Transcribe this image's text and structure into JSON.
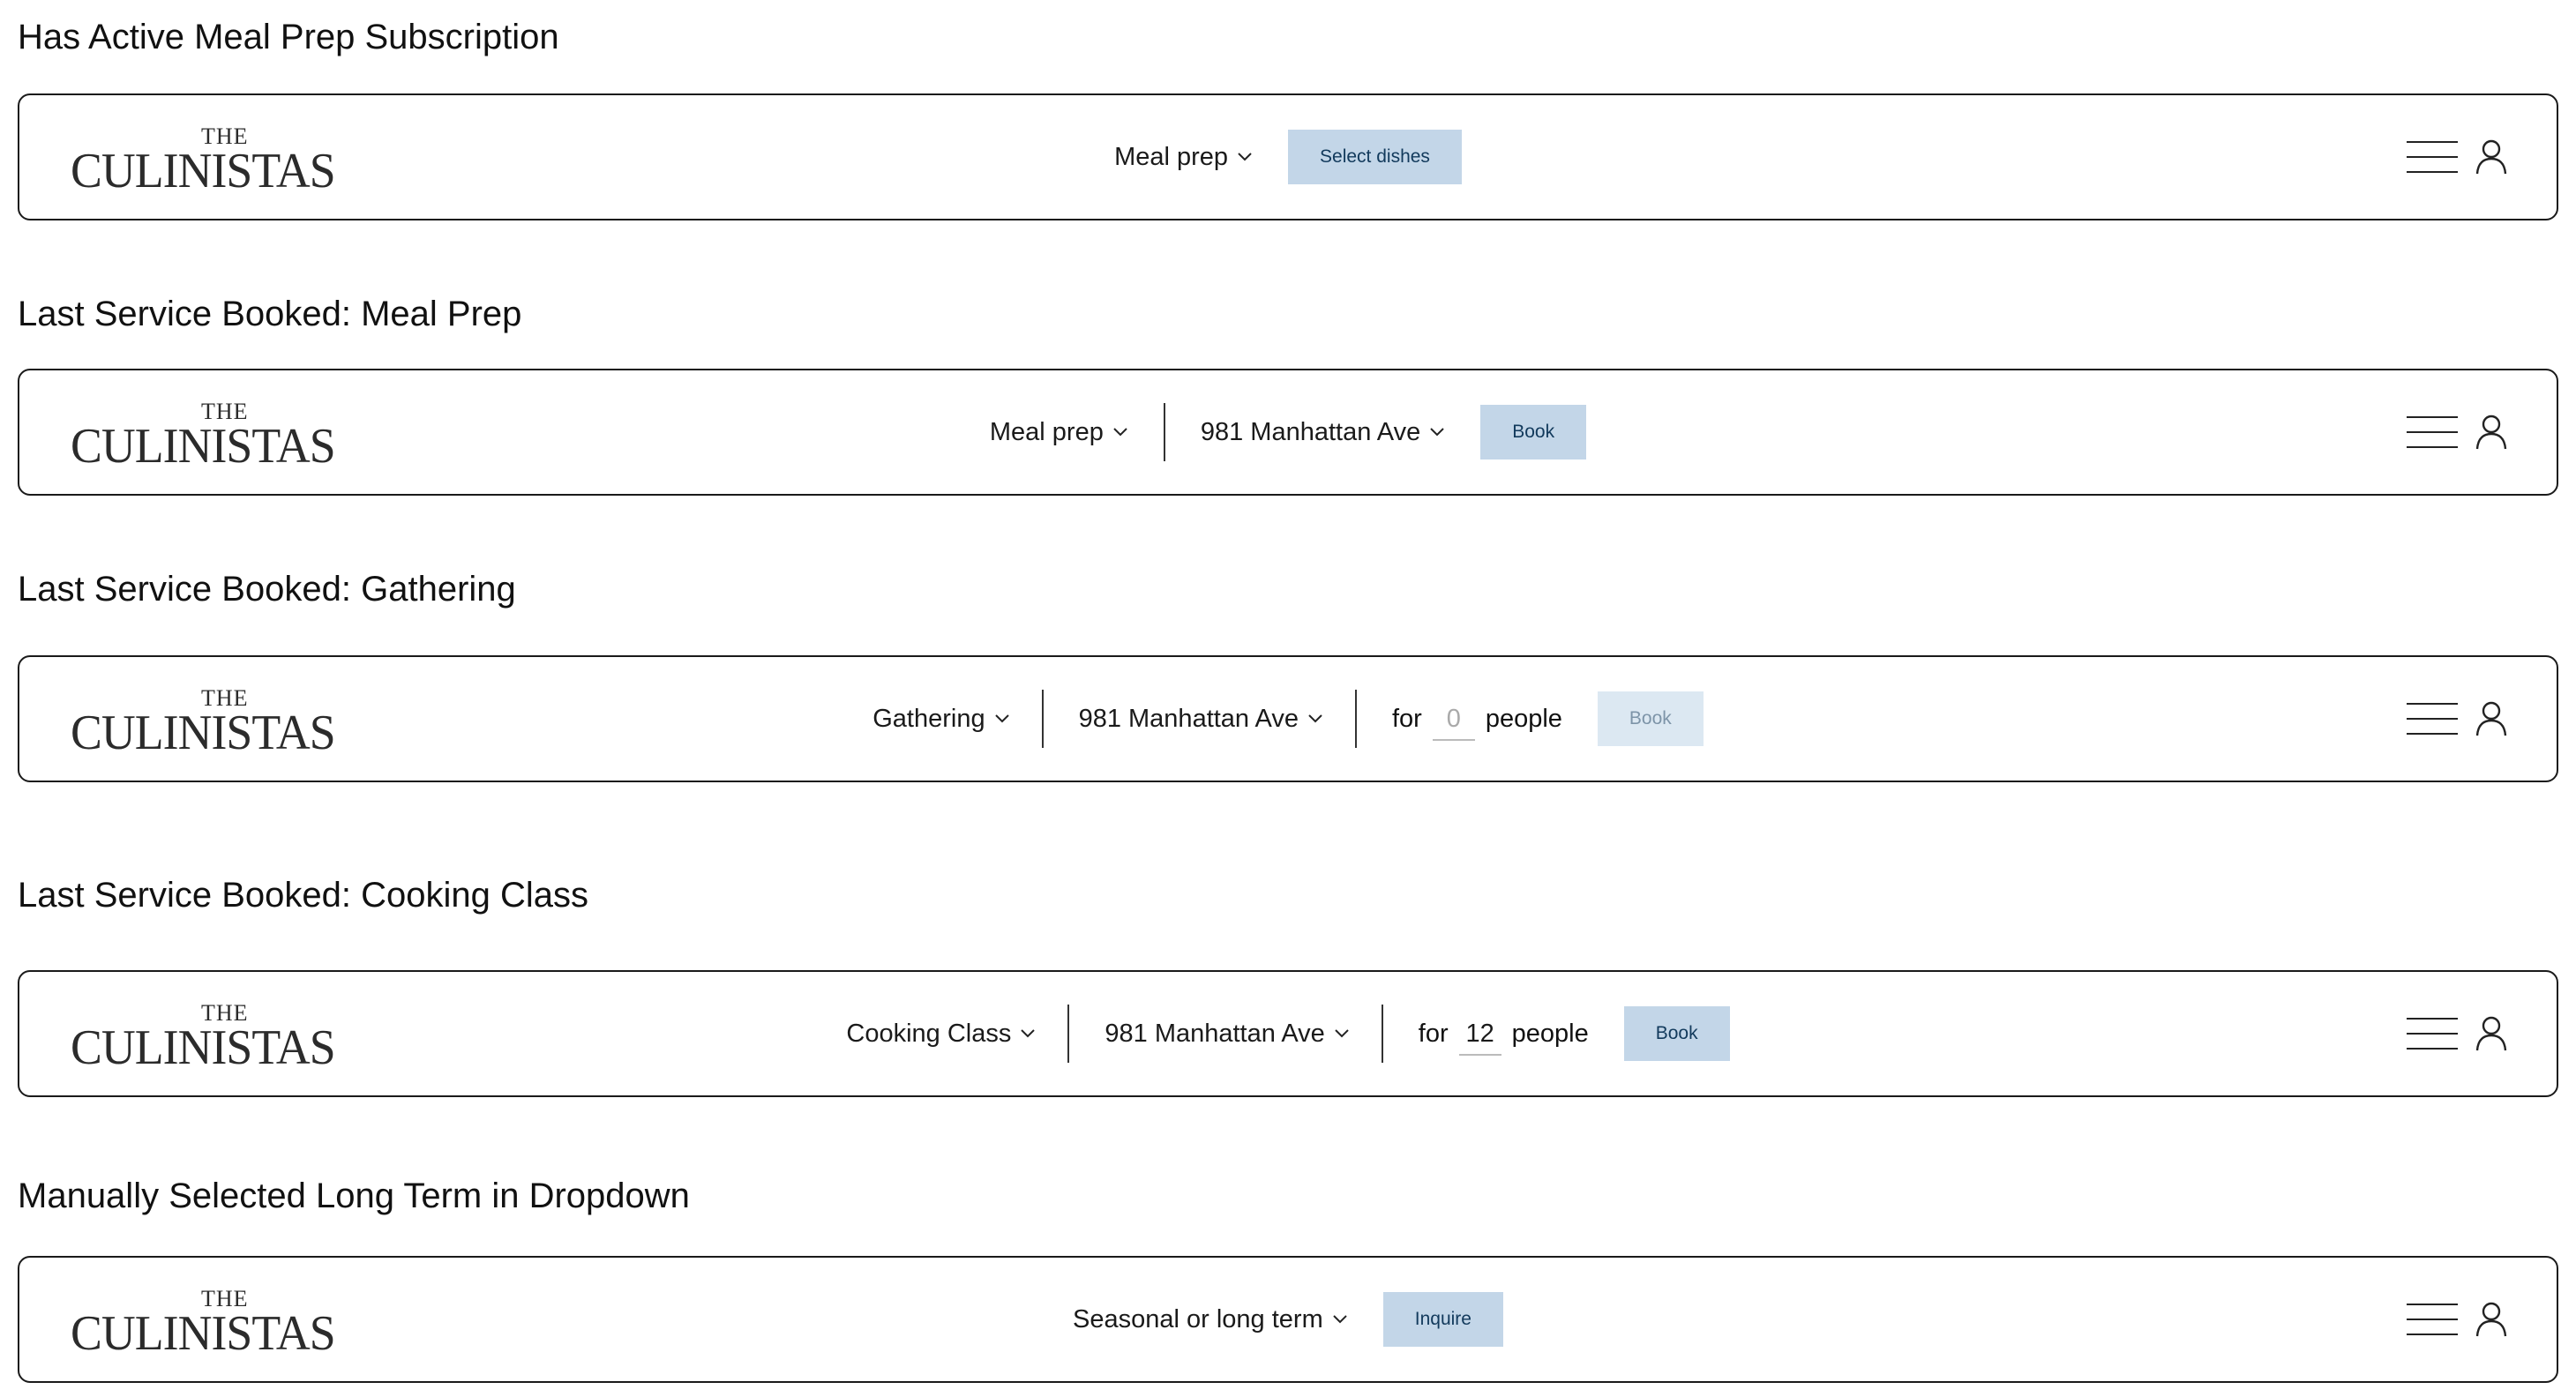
{
  "brand": {
    "the": "THE",
    "name": "CULINISTAS"
  },
  "sections": [
    {
      "heading": "Has Active Meal Prep Subscription",
      "service": "Meal prep",
      "button": "Select dishes"
    },
    {
      "heading": "Last Service Booked: Meal Prep",
      "service": "Meal prep",
      "address": "981 Manhattan Ave",
      "button": "Book"
    },
    {
      "heading": "Last Service Booked: Gathering",
      "service": "Gathering",
      "address": "981 Manhattan Ave",
      "for_label": "for",
      "people_placeholder": "0",
      "people_label": "people",
      "button": "Book",
      "button_disabled": true
    },
    {
      "heading": "Last Service Booked: Cooking Class",
      "service": "Cooking Class",
      "address": "981 Manhattan Ave",
      "for_label": "for",
      "people_value": "12",
      "people_label": "people",
      "button": "Book"
    },
    {
      "heading": "Manually Selected Long Term in Dropdown",
      "service": "Seasonal or long term",
      "button": "Inquire"
    }
  ],
  "icons": {
    "menu": "hamburger-menu-icon",
    "account": "user-account-icon",
    "dropdown": "chevron-down-icon"
  },
  "colors": {
    "button_bg": "#c3d6e8",
    "button_text": "#123a5c",
    "button_disabled_bg": "#dce8f2",
    "border": "#1a1a1a"
  }
}
